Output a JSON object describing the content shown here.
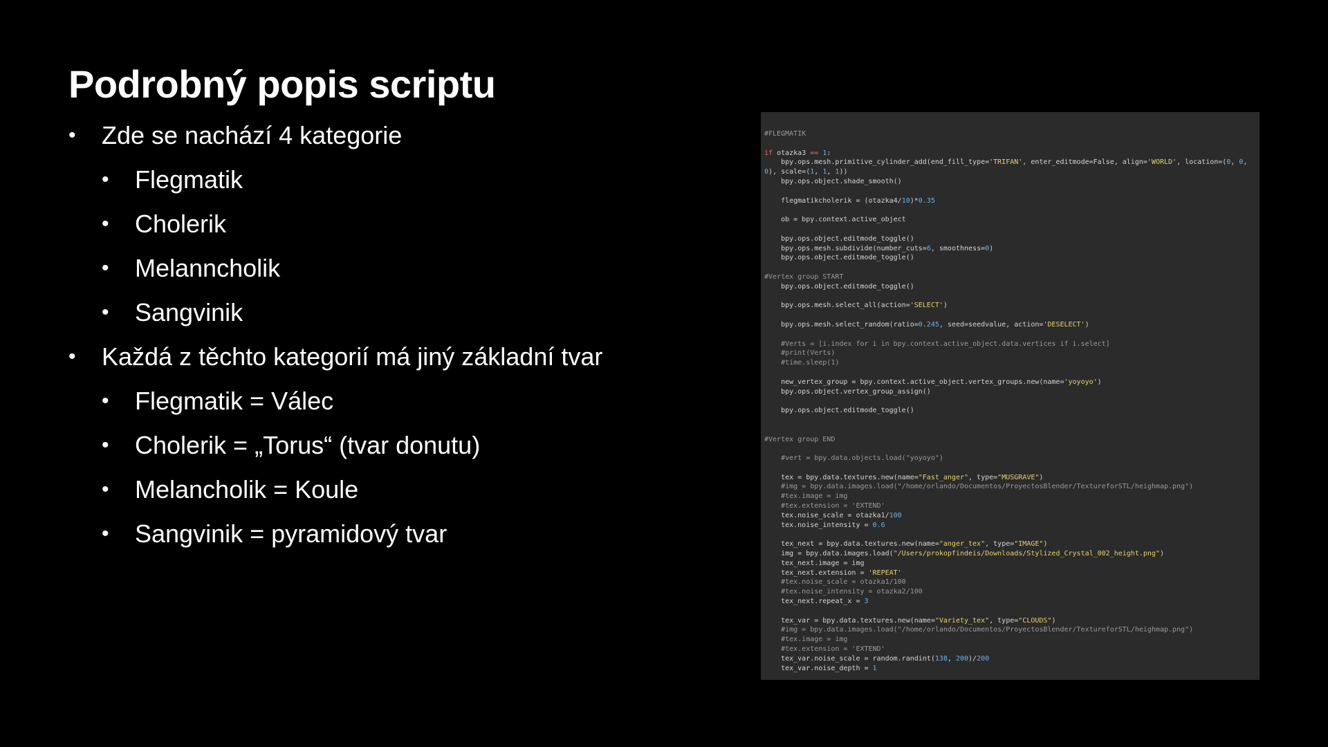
{
  "title": "Podrobný popis scriptu",
  "bullets": [
    {
      "level": 1,
      "text": "Zde se nachází 4 kategorie"
    },
    {
      "level": 2,
      "text": "Flegmatik"
    },
    {
      "level": 2,
      "text": "Cholerik"
    },
    {
      "level": 2,
      "text": "Melanncholik"
    },
    {
      "level": 2,
      "text": "Sangvinik"
    },
    {
      "level": 1,
      "text": "Každá z těchto kategorií má jiný základní tvar"
    },
    {
      "level": 2,
      "text": "Flegmatik = Válec"
    },
    {
      "level": 2,
      "text": "Cholerik = „Torus“ (tvar donutu)"
    },
    {
      "level": 2,
      "text": "Melancholik = Koule"
    },
    {
      "level": 2,
      "text": "Sangvinik = pyramidový tvar"
    }
  ],
  "bullet_glyph": "•",
  "code": {
    "colors": {
      "background": "#2b2b2b",
      "text": "#d6d6d6",
      "comment": "#9a9a9a",
      "keyword": "#e06c6c",
      "number": "#6cb4e8",
      "string": "#e8d26c"
    },
    "lines": [
      "#FLEGMATIK",
      "",
      "if otazka3 == 1:",
      "    bpy.ops.mesh.primitive_cylinder_add(end_fill_type='TRIFAN', enter_editmode=False, align='WORLD', location=(0, 0,",
      "0), scale=(1, 1, 1))",
      "    bpy.ops.object.shade_smooth()",
      "",
      "    flegmatikcholerik = (otazka4/10)*0.35",
      "",
      "    ob = bpy.context.active_object",
      "",
      "    bpy.ops.object.editmode_toggle()",
      "    bpy.ops.mesh.subdivide(number_cuts=6, smoothness=0)",
      "    bpy.ops.object.editmode_toggle()",
      "",
      "#Vertex group START",
      "    bpy.ops.object.editmode_toggle()",
      "",
      "    bpy.ops.mesh.select_all(action='SELECT')",
      "",
      "    bpy.ops.mesh.select_random(ratio=0.245, seed=seedvalue, action='DESELECT')",
      "",
      "    #Verts = [i.index for i in bpy.context.active_object.data.vertices if i.select]",
      "    #print(Verts)",
      "    #time.sleep(1)",
      "",
      "    new_vertex_group = bpy.context.active_object.vertex_groups.new(name='yoyoyo')",
      "    bpy.ops.object.vertex_group_assign()",
      "",
      "    bpy.ops.object.editmode_toggle()",
      "",
      "",
      "#Vertex group END",
      "",
      "    #vert = bpy.data.objects.load(\"yoyoyo\")",
      "",
      "    tex = bpy.data.textures.new(name=\"Fast_anger\", type=\"MUSGRAVE\")",
      "    #img = bpy.data.images.load(\"/home/orlando/Documentos/ProyectosBlender/TextureforSTL/heighmap.png\")",
      "    #tex.image = img",
      "    #tex.extension = 'EXTEND'",
      "    tex.noise_scale = otazka1/100",
      "    tex.noise_intensity = 0.6",
      "",
      "    tex_next = bpy.data.textures.new(name=\"anger_tex\", type=\"IMAGE\")",
      "    img = bpy.data.images.load(\"/Users/prokopfindeis/Downloads/Stylized_Crystal_002_height.png\")",
      "    tex_next.image = img",
      "    tex_next.extension = 'REPEAT'",
      "    #tex.noise_scale = otazka1/100",
      "    #tex.noise_intensity = otazka2/100",
      "    tex_next.repeat_x = 3",
      "",
      "    tex_var = bpy.data.textures.new(name=\"Variety_tex\", type=\"CLOUDS\")",
      "    #img = bpy.data.images.load(\"/home/orlando/Documentos/ProyectosBlender/TextureforSTL/heighmap.png\")",
      "    #tex.image = img",
      "    #tex.extension = 'EXTEND'",
      "    tex_var.noise_scale = random.randint(138, 200)/200",
      "    tex_var.noise_depth = 1"
    ]
  }
}
